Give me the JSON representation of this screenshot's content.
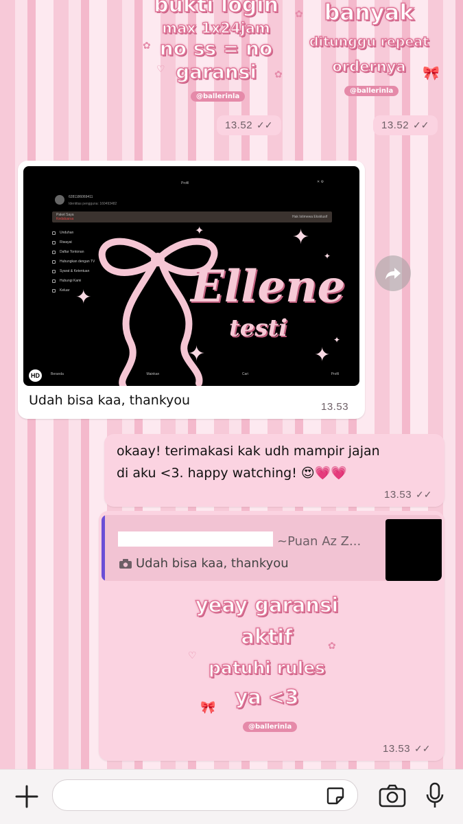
{
  "sticker_left": {
    "line1": "bukti login",
    "line2": "max 1x24jam",
    "line3": "no ss = no",
    "line4": "garansi",
    "credit": "@ballerinla"
  },
  "sticker_right": {
    "line1": "banyak",
    "line2": "ditunggu repeat",
    "line3": "ordernya",
    "credit": "@ballerinla"
  },
  "timestamps": {
    "sticker_left": "13.52",
    "sticker_right": "13.52"
  },
  "image_message": {
    "profile_title": "Profil",
    "phone": "6281186069411",
    "user_id": "Identitas pengguna: 160493482",
    "package_label": "Paket Saya",
    "package_status": "Kedaluarsa",
    "exclusive_label": "Hak Istimewa Eksklusif",
    "menu": [
      "Unduhan",
      "Riwayat",
      "Daftar Tontonan",
      "Hubungkan dengan TV",
      "Syarat & Ketentuan",
      "Hubungi Kami",
      "Keluar"
    ],
    "tabs": [
      "Beranda",
      "Mainkan",
      "Cari",
      "Profil"
    ],
    "hd_badge": "HD",
    "overlay_title": "Ellene",
    "overlay_subtitle": "testi",
    "caption": "Udah bisa kaa, thankyou",
    "time": "13.53"
  },
  "outgoing_message": {
    "text_line1": "okaay! terimakasi kak udh mampir jajan",
    "text_line2": "di aku <3. happy watching! 😍💗💗",
    "time": "13.53"
  },
  "reply_message": {
    "quoted_author": "~Puan Az Z...",
    "quoted_text": "Udah bisa kaa, thankyou",
    "sticker_line1": "yeay garansi",
    "sticker_line2": "aktif",
    "sticker_line3": "patuhi rules",
    "sticker_line4": "ya <3",
    "credit": "@ballerinla",
    "time": "13.53"
  },
  "colors": {
    "accent_pink": "#e0789a",
    "outgoing_bubble": "#fbd3e1",
    "quote_bar": "#6a4fd6"
  }
}
